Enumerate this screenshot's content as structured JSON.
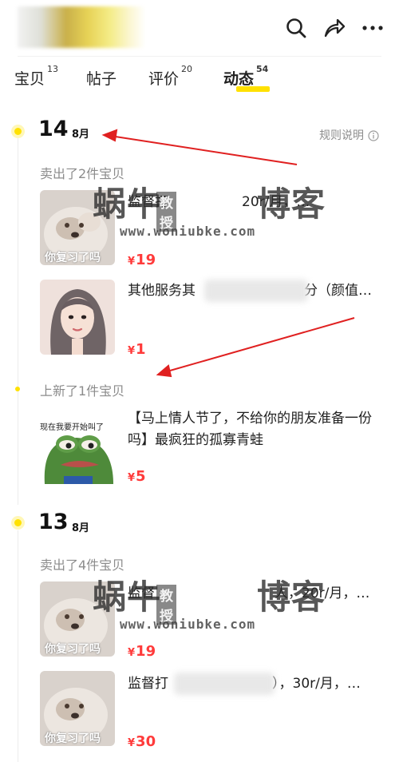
{
  "header": {
    "icons": [
      "search-icon",
      "share-icon",
      "more-icon"
    ]
  },
  "tabs": [
    {
      "label": "宝贝",
      "count": "13"
    },
    {
      "label": "帖子",
      "count": ""
    },
    {
      "label": "评价",
      "count": "20"
    },
    {
      "label": "动态",
      "count": "54",
      "active": true
    }
  ],
  "timeline": {
    "rules_label": "规则说明",
    "day1": {
      "day": "14",
      "month": "8月",
      "sold_label": "卖出了2件宝贝",
      "sold_items": [
        {
          "title": "监督打",
          "title_tail": "20r/月，…",
          "price": "19"
        },
        {
          "title": "其他服务其",
          "title_tail": "分（颜值…",
          "price": "1"
        }
      ],
      "new_label": "上新了1件宝贝",
      "new_items": [
        {
          "title": "【马上情人节了，不给你的朋友准备一份吗】最疯狂的孤寡青蛙",
          "price": "5",
          "thumb_caption": "现在我要开始叫了"
        }
      ]
    },
    "day2": {
      "day": "13",
      "month": "8月",
      "sold_label": "卖出了4件宝贝",
      "sold_items": [
        {
          "title": "监督",
          "title_tail": "人，20r/月，…",
          "price": "19"
        },
        {
          "title": "监督打",
          "title_tail": "），30r/月，…",
          "price": "30"
        }
      ]
    },
    "thumb_caption_dog": "你复习了吗"
  },
  "watermark": {
    "big": [
      "蜗牛",
      "博客"
    ],
    "small": "教授",
    "url": "www.woniubke.com"
  },
  "colors": {
    "accent_yellow": "#ffe100",
    "price_red": "#ff3b3b",
    "muted_gray": "#8c8c8c",
    "arrow_red": "#e02020"
  }
}
